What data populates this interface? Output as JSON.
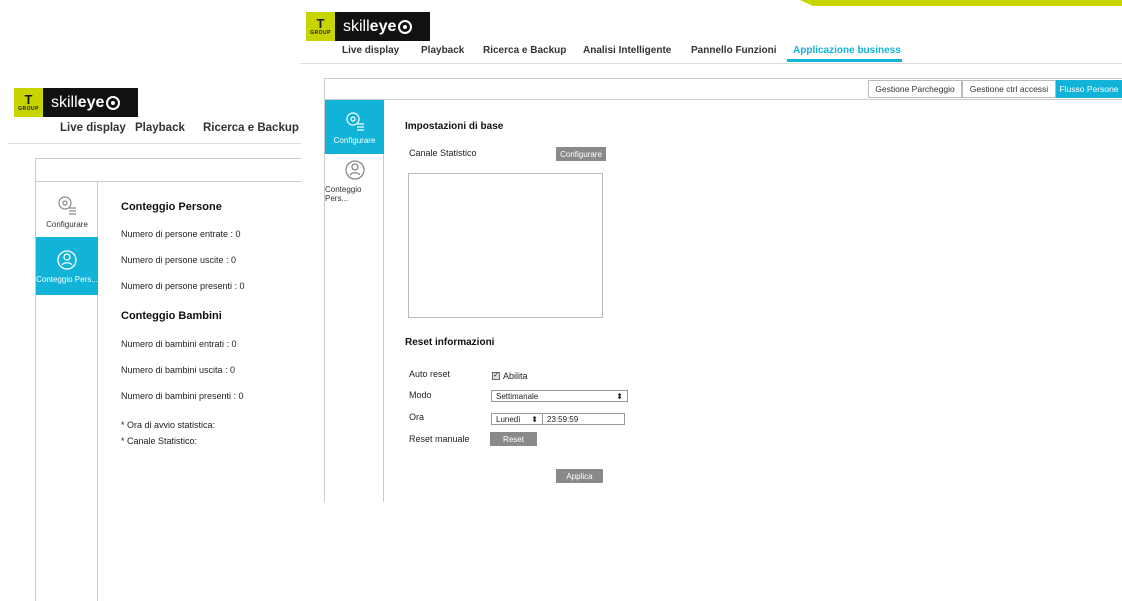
{
  "brand": {
    "group_mark": "T<small>GROUP</small>",
    "name_light": "skill",
    "name_bold": "eye"
  },
  "left": {
    "nav": [
      "Live display",
      "Playback",
      "Ricerca e Backup"
    ],
    "sidebar": [
      {
        "label": "Configurare",
        "icon": "gear-list-icon"
      },
      {
        "label": "Conteggio Pers...",
        "icon": "person-count-icon"
      }
    ],
    "people_title": "Conteggio Persone",
    "people": [
      "Numero di persone entrate :  0",
      "Numero di persone uscite :  0",
      "Numero di persone presenti :  0"
    ],
    "children_title": "Conteggio Bambini",
    "children": [
      "Numero di bambini entrati :  0",
      "Numero di bambini uscita :  0",
      "Numero di bambini presenti :  0"
    ],
    "notes": [
      "* Ora di avvio statistica:",
      "* Canale Statistico:"
    ]
  },
  "right": {
    "nav": [
      "Live display",
      "Playback",
      "Ricerca e Backup",
      "Analisi Intelligente",
      "Pannello Funzioni",
      "Applicazione business"
    ],
    "tabs": [
      "Gestione Parcheggio",
      "Gestione ctrl accessi",
      "Flusso Persone"
    ],
    "sidebar": [
      {
        "label": "Configurare"
      },
      {
        "label": "Conteggio Pers..."
      }
    ],
    "basic_title": "Impostazioni di base",
    "channel_label": "Canale Statistico",
    "configure_button": "Configurare",
    "reset_title": "Reset informazioni",
    "auto_reset_label": "Auto reset",
    "enable_label": "Abilita",
    "mode_label": "Modo",
    "mode_value": "Settimanale",
    "time_label": "Ora",
    "day_value": "Lunedì",
    "time_value": "23:59:59",
    "manual_reset_label": "Reset manuale",
    "reset_button": "Reset",
    "apply_button": "Applica"
  },
  "colors": {
    "accent": "#12b3d8",
    "lime": "#c8d400"
  }
}
